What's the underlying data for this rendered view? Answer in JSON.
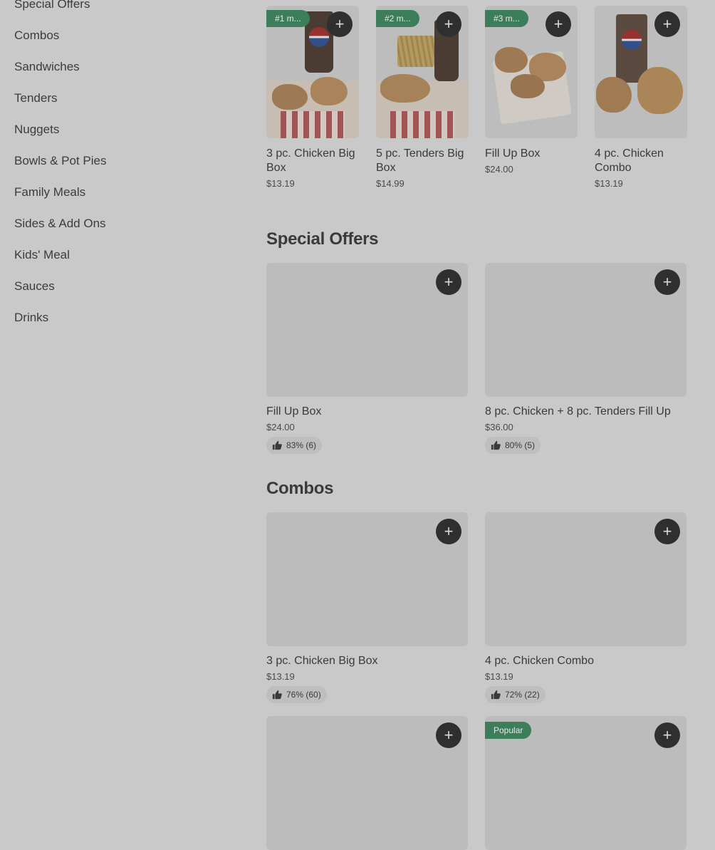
{
  "sidebar": {
    "items": [
      {
        "label": "Special Offers"
      },
      {
        "label": "Combos"
      },
      {
        "label": "Sandwiches"
      },
      {
        "label": "Tenders"
      },
      {
        "label": "Nuggets"
      },
      {
        "label": "Bowls & Pot Pies"
      },
      {
        "label": "Family Meals"
      },
      {
        "label": "Sides & Add Ons"
      },
      {
        "label": "Kids' Meal"
      },
      {
        "label": "Sauces"
      },
      {
        "label": "Drinks"
      }
    ]
  },
  "top_picks": [
    {
      "rank": "#1 m...",
      "title": "3 pc. Chicken Big Box",
      "price": "$13.19"
    },
    {
      "rank": "#2 m...",
      "title": "5 pc. Tenders Big Box",
      "price": "$14.99"
    },
    {
      "rank": "#3 m...",
      "title": "Fill Up Box",
      "price": "$24.00"
    },
    {
      "rank": "",
      "title": "4 pc. Chicken Combo",
      "price": "$13.19"
    }
  ],
  "special_offers": {
    "title": "Special Offers",
    "items": [
      {
        "title": "Fill Up Box",
        "price": "$24.00",
        "rating": "83% (6)"
      },
      {
        "title": "8 pc. Chicken + 8 pc. Tenders Fill Up",
        "price": "$36.00",
        "rating": "80% (5)"
      }
    ]
  },
  "combos": {
    "title": "Combos",
    "items": [
      {
        "title": "3 pc. Chicken Big Box",
        "price": "$13.19",
        "rating": "76% (60)"
      },
      {
        "title": "4 pc. Chicken Combo",
        "price": "$13.19",
        "rating": "72% (22)"
      }
    ],
    "popular_label": "Popular"
  },
  "icons": {
    "add": "plus-icon",
    "rating": "thumbs-up-icon"
  },
  "colors": {
    "badge": "#3c7d5a",
    "button": "#2f2f2f",
    "background": "#c9c9c9"
  },
  "add_symbol": "+"
}
